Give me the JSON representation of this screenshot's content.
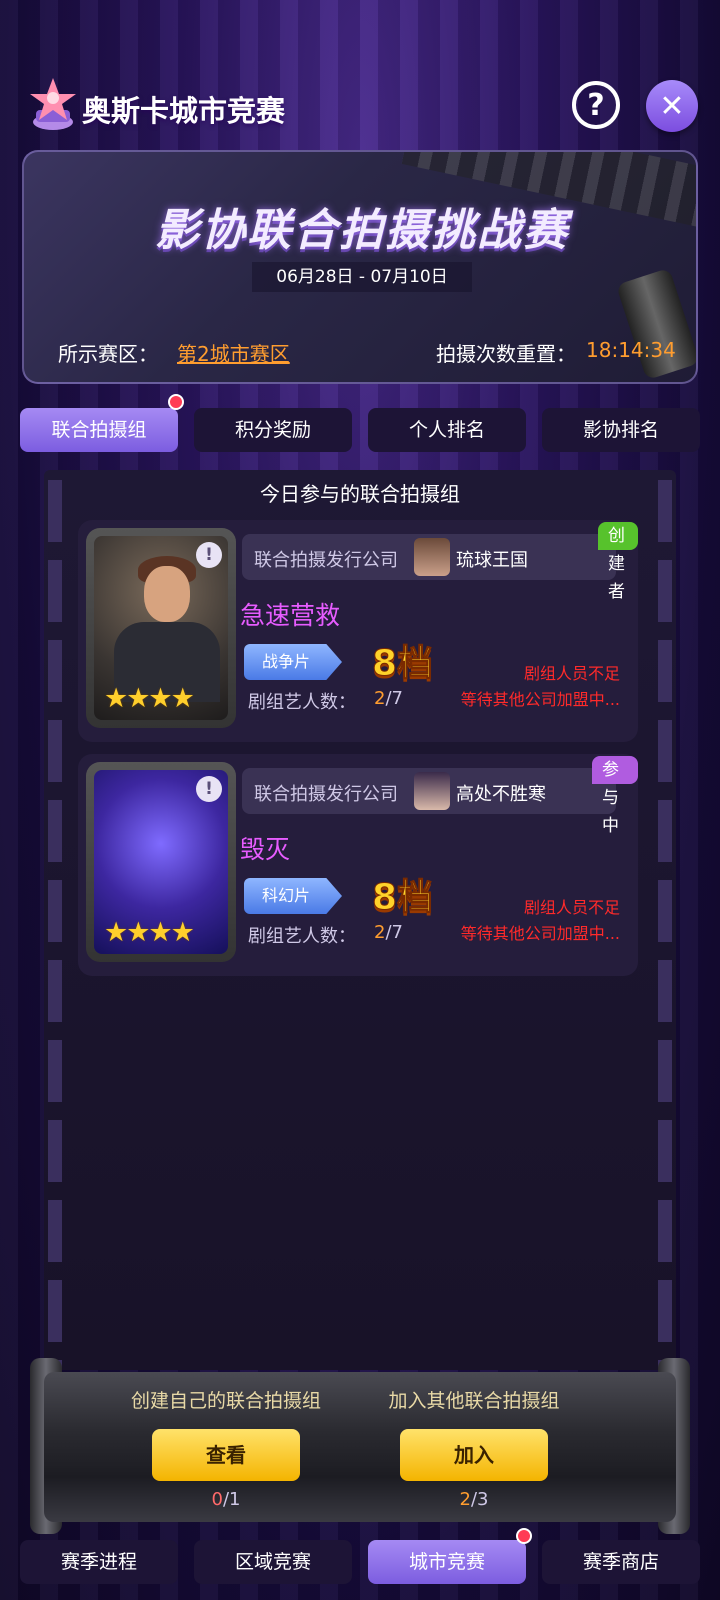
{
  "header": {
    "title": "奥斯卡城市竞赛",
    "help_icon": "question-icon",
    "close_icon": "close-icon"
  },
  "banner": {
    "title": "影协联合拍摄挑战赛",
    "date_range": "06月28日 - 07月10日",
    "zone_label": "所示赛区：",
    "zone_value": "第2城市赛区",
    "reset_label": "拍摄次数重置：",
    "reset_value": "18:14:34"
  },
  "tabs": [
    {
      "label": "联合拍摄组",
      "active": true,
      "dot": true
    },
    {
      "label": "积分奖励"
    },
    {
      "label": "个人排名"
    },
    {
      "label": "影协排名"
    }
  ],
  "panel": {
    "title": "今日参与的联合拍摄组",
    "cards": [
      {
        "company_label": "联合拍摄发行公司",
        "company_name": "琉球王国",
        "badge": "创建者",
        "movie_title": "急速营救",
        "genre": "战争片",
        "grade": "8档",
        "stars": "★★★★",
        "crew_label": "剧组艺人数：",
        "crew_current": "2",
        "crew_total": "/7",
        "status_line1": "剧组人员不足",
        "status_line2": "等待其他公司加盟中..."
      },
      {
        "company_label": "联合拍摄发行公司",
        "company_name": "高处不胜寒",
        "badge": "参与中",
        "movie_title": "毁灭",
        "genre": "科幻片",
        "grade": "8档",
        "stars": "★★★★",
        "crew_label": "剧组艺人数：",
        "crew_current": "2",
        "crew_total": "/7",
        "status_line1": "剧组人员不足",
        "status_line2": "等待其他公司加盟中..."
      }
    ]
  },
  "actions": {
    "create": {
      "label": "创建自己的联合拍摄组",
      "button": "查看",
      "current": "0",
      "total": "/1"
    },
    "join": {
      "label": "加入其他联合拍摄组",
      "button": "加入",
      "current": "2",
      "total": "/3"
    }
  },
  "bottom_nav": [
    {
      "label": "赛季进程"
    },
    {
      "label": "区域竞赛"
    },
    {
      "label": "城市竞赛",
      "active": true,
      "dot": true
    },
    {
      "label": "赛季商店"
    }
  ],
  "colors": {
    "accent": "#8b6cea",
    "highlight_orange": "#ff9d2f",
    "warning_red": "#ff2a2a",
    "title_pink": "#e75cff",
    "creator_green": "#57c22c",
    "joined_purple": "#b05ce0"
  }
}
